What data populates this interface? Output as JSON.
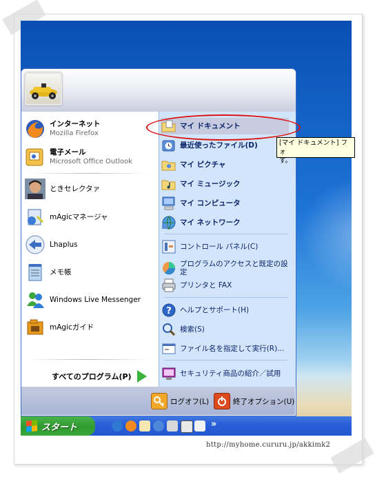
{
  "left_items": [
    {
      "name": "Firefox",
      "title": "インターネット",
      "subtitle": "Mozilla Firefox"
    },
    {
      "name": "Outlook",
      "title": "電子メール",
      "subtitle": "Microsoft Office Outlook"
    },
    {
      "label": "ときセレクタァ"
    },
    {
      "label": "mAgicマネージャ"
    },
    {
      "label": "Lhaplus"
    },
    {
      "label": "メモ帳"
    },
    {
      "label": "Windows Live Messenger"
    },
    {
      "label": "mAgicガイド"
    }
  ],
  "all_programs": "すべてのプログラム(P)",
  "right_items": [
    {
      "label": "マイ ドキュメント",
      "bold": true
    },
    {
      "label": "最近使ったファイル(D)",
      "bold": true
    },
    {
      "label": "マイ ピクチャ",
      "bold": true
    },
    {
      "label": "マイ ミュージック",
      "bold": true
    },
    {
      "label": "マイ コンピュータ",
      "bold": true
    },
    {
      "label": "マイ ネットワーク",
      "bold": true
    },
    {
      "label": "コントロール パネル(C)"
    },
    {
      "label": "プログラムのアクセスと既定の設定",
      "lines": [
        "プログラムのアクセスと既定の設",
        "定"
      ]
    },
    {
      "label": "プリンタと FAX"
    },
    {
      "label": "ヘルプとサポート(H)"
    },
    {
      "label": "検索(S)"
    },
    {
      "label": "ファイル名を指定して実行(R)..."
    },
    {
      "label": "セキュリティ商品の紹介／試用"
    }
  ],
  "footer": {
    "logoff": "ログオフ(L)",
    "shutdown": "終了オプション(U)"
  },
  "taskbar": {
    "start": "スタート",
    "chevron": "»"
  },
  "tooltip": {
    "line1": "[マイ ドキュメント] フォ",
    "line2": "す。"
  },
  "watermark": "http://myhome.cururu.jp/akkimk2",
  "colors": {
    "accent_blue": "#0a246a",
    "highlight": "#c6cbe0",
    "ellipse": "#dd1111",
    "start_green": "#3aa83a",
    "taskbar_blue": "#2458cf"
  }
}
